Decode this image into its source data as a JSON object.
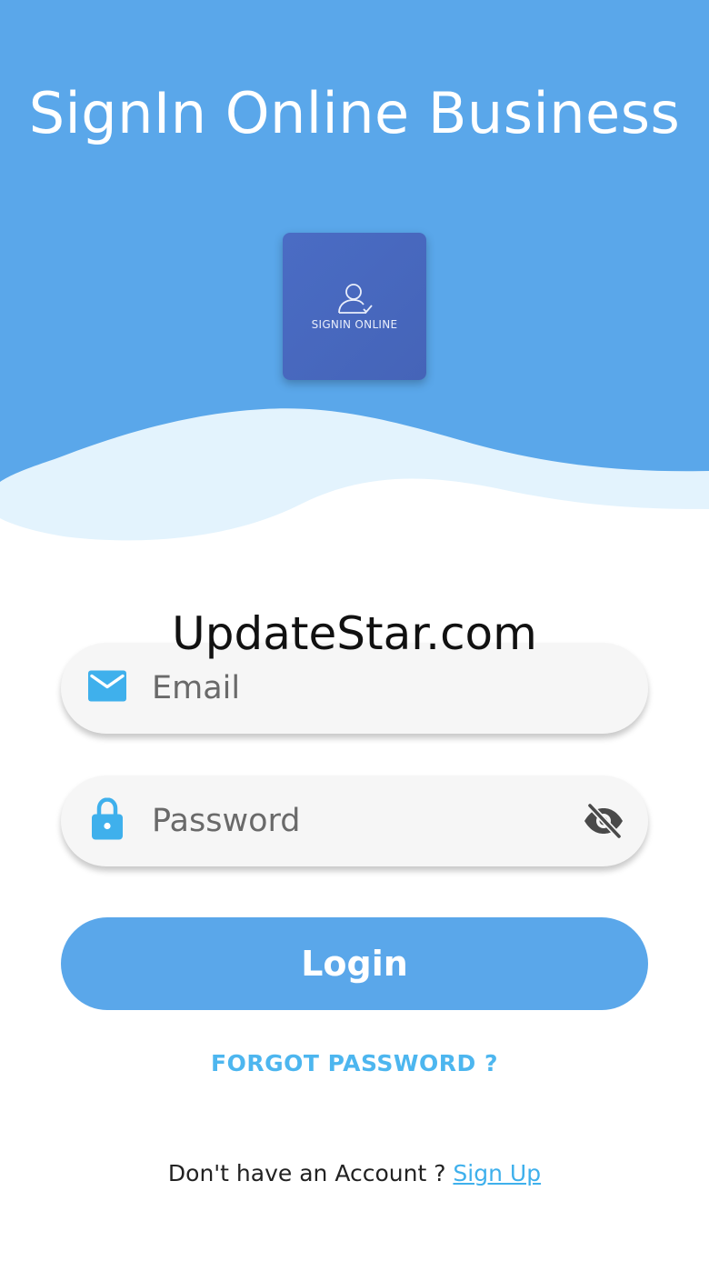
{
  "header": {
    "title": "SignIn Online Business"
  },
  "logo": {
    "icon": "user-check-icon",
    "text": "SIGNIN ONLINE"
  },
  "watermark": "UpdateStar.com",
  "form": {
    "email": {
      "icon": "mail-icon",
      "placeholder": "Email",
      "value": ""
    },
    "password": {
      "icon": "lock-icon",
      "placeholder": "Password",
      "value": "",
      "toggle_icon": "eye-off-icon"
    },
    "login_label": "Login",
    "forgot_label": "FORGOT PASSWORD ?",
    "signup_prompt": "Don't have an Account ? ",
    "signup_label": "Sign Up "
  },
  "colors": {
    "primary": "#5aa7ea",
    "wave_light": "#e3f3fd",
    "logo_bg": "#4a6cc4",
    "accent_text": "#4db6ef",
    "icon": "#3fb0ec"
  }
}
